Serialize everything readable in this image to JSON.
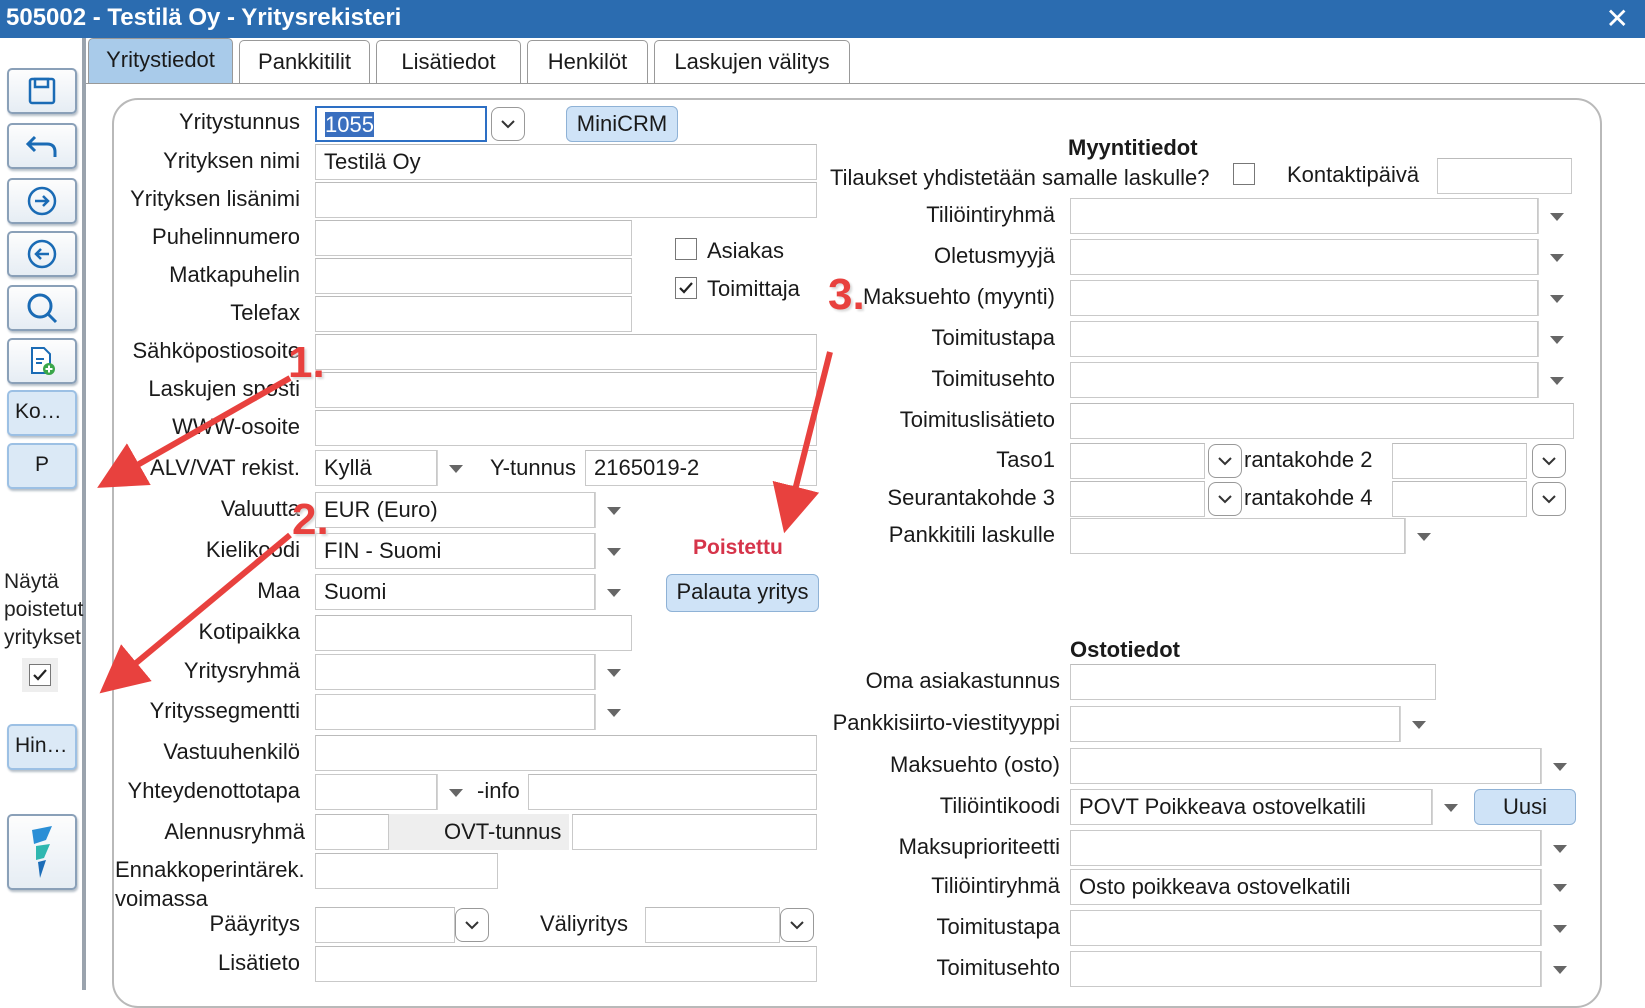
{
  "window": {
    "title": "505002 - Testilä Oy - Yritysrekisteri",
    "close": "✕"
  },
  "sidebar": {
    "buttons": [
      {
        "name": "save-icon"
      },
      {
        "name": "undo-icon"
      },
      {
        "name": "forward-icon"
      },
      {
        "name": "back-icon"
      },
      {
        "name": "search-icon"
      },
      {
        "name": "new-document-icon"
      }
    ],
    "ko_label": "Ko…",
    "p_label": "P",
    "show_deleted_label": [
      "Näytä",
      "poistetut",
      "yritykset"
    ],
    "show_deleted_checked": true,
    "hin_label": "Hin…",
    "logo": "app-logo-icon"
  },
  "tabs": [
    "Yritystiedot",
    "Pankkitilit",
    "Lisätiedot",
    "Henkilöt",
    "Laskujen välitys"
  ],
  "left": {
    "yritystunnus_label": "Yritystunnus",
    "yritystunnus_value": "1055",
    "minicrm_label": "MiniCRM",
    "yrityksen_nimi_label": "Yrityksen nimi",
    "yrityksen_nimi_value": "Testilä Oy",
    "lisanimi_label": "Yrityksen lisänimi",
    "puhelin_label": "Puhelinnumero",
    "matkapuhelin_label": "Matkapuhelin",
    "telefax_label": "Telefax",
    "sahkoposti_label": "Sähköpostiosoite",
    "laskujen_sposti_label": "Laskujen sposti",
    "www_label": "WWW-osoite",
    "alv_label": "ALV/VAT rekist.",
    "alv_value": "Kyllä",
    "ytunnus_label": "Y-tunnus",
    "ytunnus_value": "2165019-2",
    "valuutta_label": "Valuutta",
    "valuutta_value": "EUR (Euro)",
    "kielikoodi_label": "Kielikoodi",
    "kielikoodi_value": "FIN - Suomi",
    "maa_label": "Maa",
    "maa_value": "Suomi",
    "kotipaikka_label": "Kotipaikka",
    "yritysryhma_label": "Yritysryhmä",
    "yrityssegmentti_label": "Yrityssegmentti",
    "vastuuhenkilo_label": "Vastuuhenkilö",
    "yhteydenottotapa_label": "Yhteydenottotapa",
    "info_label": "-info",
    "alennusryhma_label": "Alennusryhmä",
    "ovt_label": "OVT-tunnus",
    "ennakko_label_1": "Ennakkoperintärek.",
    "ennakko_label_2": "voimassa",
    "paayritys_label": "Pääyritys",
    "valiyritys_label": "Väliyritys",
    "lisatieto_label": "Lisätieto",
    "asiakas_label": "Asiakas",
    "asiakas_checked": false,
    "toimittaja_label": "Toimittaja",
    "toimittaja_checked": true,
    "poistettu_label": "Poistettu",
    "palauta_label": "Palauta yritys"
  },
  "sales": {
    "title": "Myyntitiedot",
    "tilaukset_label": "Tilaukset yhdistetään samalle laskulle?",
    "kontaktipaiva_label": "Kontaktipäivä",
    "tiliointiryhma_label": "Tiliöintiryhmä",
    "oletusmyyja_label": "Oletusmyyjä",
    "maksuehto_label": "Maksuehto (myynti)",
    "toimitustapa_label": "Toimitustapa",
    "toimitusehto_label": "Toimitusehto",
    "toimituslisatieto_label": "Toimituslisätieto",
    "taso1_label": "Taso1",
    "seurantakohde2_label": "rantakohde 2",
    "seurantakohde3_label": "Seurantakohde 3",
    "seurantakohde4_label": "rantakohde 4",
    "pankkitili_label": "Pankkitili laskulle"
  },
  "purchase": {
    "title": "Ostotiedot",
    "oma_asiakastunnus_label": "Oma asiakastunnus",
    "pankkisiirto_label": "Pankkisiirto-viestityyppi",
    "maksuehto_label": "Maksuehto (osto)",
    "tiliointikoodi_label": "Tiliöintikoodi",
    "tiliointikoodi_value": "POVT Poikkeava ostovelkatili",
    "uusi_label": "Uusi",
    "maksuprioriteetti_label": "Maksuprioriteetti",
    "tiliointiryhma_label": "Tiliöintiryhmä",
    "tiliointiryhma_value": "Osto poikkeava ostovelkatili",
    "toimitustapa_label": "Toimitustapa",
    "toimitusehto_label": "Toimitusehto"
  },
  "annotations": [
    "1.",
    "2.",
    "3."
  ],
  "colors": {
    "titlebar": "#2b6cb0",
    "active_tab": "#a9cbea",
    "button": "#cfe3f7",
    "annotation": "#e8413e",
    "deleted_text": "#d6344a"
  }
}
